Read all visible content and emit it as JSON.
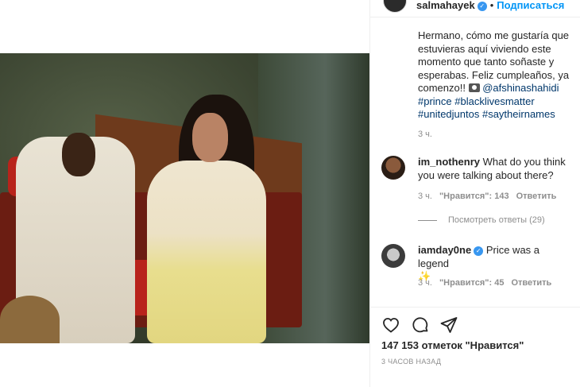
{
  "post": {
    "photo_alt": "",
    "author": "salmahayek",
    "follow_label": "Подписаться",
    "caption_text": "Hermano, cómo me gustaría que estuvieras aquí viviendo este momento que tanto soñaste y esperabas. Feliz cumpleaños, ya comenzo!! ",
    "caption_mention": "@afshinashahidi",
    "caption_tags": [
      "#prince",
      "#blacklivesmatter",
      "#unitedjuntos",
      "#saytheirnames"
    ],
    "caption_time": "3 ч."
  },
  "comments": [
    {
      "user": "im_nothenry",
      "text": "What do you think you were talking about there?",
      "time": "3 ч.",
      "likes": "\"Нравится\": 143",
      "reply": "Ответить",
      "view_replies": "Посмотреть ответы (29)"
    },
    {
      "user": "iamday0ne",
      "text": "Price was a legend",
      "emoji": "✨",
      "time": "3 ч.",
      "likes": "\"Нравится\": 45",
      "reply": "Ответить"
    }
  ],
  "actions": {
    "like_count": "147 153 отметок \"Нравится\"",
    "posted": "3 ЧАСОВ НАЗАД"
  },
  "colors": {
    "accent": "#0095f6",
    "verified": "#3897f0",
    "muted": "#8e8e8e",
    "link": "#00376b"
  },
  "icons": [
    "verified-badge-icon",
    "camera-emoji-icon",
    "heart-icon",
    "comment-icon",
    "share-icon",
    "comment-like-heart-icon",
    "sparkle-emoji-icon"
  ]
}
